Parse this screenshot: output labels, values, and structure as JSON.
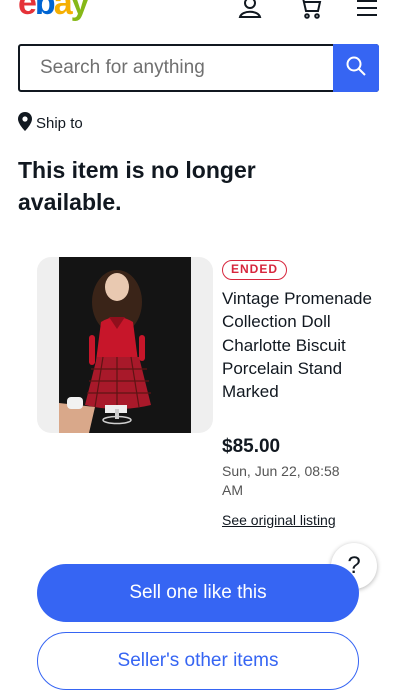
{
  "header": {
    "logo": {
      "e": "e",
      "b": "b",
      "a": "a",
      "y": "y"
    },
    "icons": [
      "account-icon",
      "cart-icon",
      "menu-icon"
    ]
  },
  "search": {
    "placeholder": "Search for anything",
    "value": ""
  },
  "ship_to": {
    "label": "Ship to"
  },
  "headline": "This item is no longer available.",
  "listing": {
    "status_badge": "ENDED",
    "title": "Vintage Promenade Collection Doll Charlotte Biscuit Porcelain Stand Marked",
    "price": "$85.00",
    "end_date": "Sun, Jun 22, 08:58 AM",
    "original_link": "See original listing"
  },
  "help": {
    "label": "?"
  },
  "actions": {
    "primary": "Sell one like this",
    "secondary": "Seller's other items"
  },
  "colors": {
    "accent": "#3665f3",
    "ended_badge": "#d7263d",
    "logo_e": "#e53238",
    "logo_b": "#0064d2",
    "logo_a": "#f5af02",
    "logo_y": "#86b817"
  }
}
